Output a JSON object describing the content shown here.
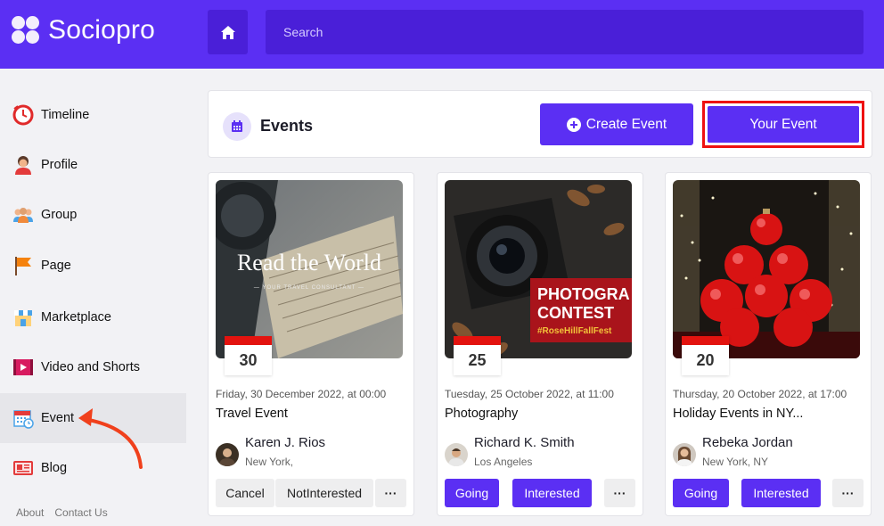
{
  "header": {
    "brand": "Sociopro",
    "search_placeholder": "Search"
  },
  "sidebar": {
    "items": [
      {
        "label": "Timeline",
        "icon": "timeline-clock-icon"
      },
      {
        "label": "Profile",
        "icon": "profile-person-icon"
      },
      {
        "label": "Group",
        "icon": "group-people-icon"
      },
      {
        "label": "Page",
        "icon": "page-flag-icon"
      },
      {
        "label": "Marketplace",
        "icon": "marketplace-store-icon"
      },
      {
        "label": "Video and Shorts",
        "icon": "video-play-icon"
      },
      {
        "label": "Event",
        "icon": "event-calendar-icon",
        "active": true
      },
      {
        "label": "Blog",
        "icon": "blog-icon"
      }
    ],
    "footer": {
      "about": "About",
      "contact": "Contact Us"
    }
  },
  "events": {
    "title": "Events",
    "create_label": "Create Event",
    "your_event_label": "Your Event"
  },
  "cards": [
    {
      "day": "30",
      "date": "Friday, 30 December 2022, at 00:00",
      "title": "Travel Event",
      "image_text": "Read the World",
      "image_subtext": "— YOUR TRAVEL CONSULTANT —",
      "host": "Karen J. Rios",
      "location": "New York,",
      "actions": [
        "Cancel",
        "NotInterested"
      ],
      "more": "···"
    },
    {
      "day": "25",
      "date": "Tuesday, 25 October 2022, at 11:00",
      "title": "Photography",
      "image_text": "PHOTOGRA CONTEST",
      "image_line1": "PHOTOGRA",
      "image_line2": "CONTEST",
      "image_tag": "#RoseHillFallFest",
      "host": "Richard K. Smith",
      "location": "Los Angeles",
      "actions": [
        "Going",
        "Interested"
      ],
      "more": "···"
    },
    {
      "day": "20",
      "date": "Thursday, 20 October 2022, at 17:00",
      "title": "Holiday Events in NY...",
      "host": "Rebeka Jordan",
      "location": "New York, NY",
      "actions": [
        "Going",
        "Interested"
      ],
      "more": "···"
    }
  ],
  "colors": {
    "brand": "#5b2ff3",
    "brand_dark": "#4a1fd8",
    "highlight_border": "#ee1111",
    "annotation_arrow": "#f0401c",
    "badge_red": "#e3130f"
  }
}
